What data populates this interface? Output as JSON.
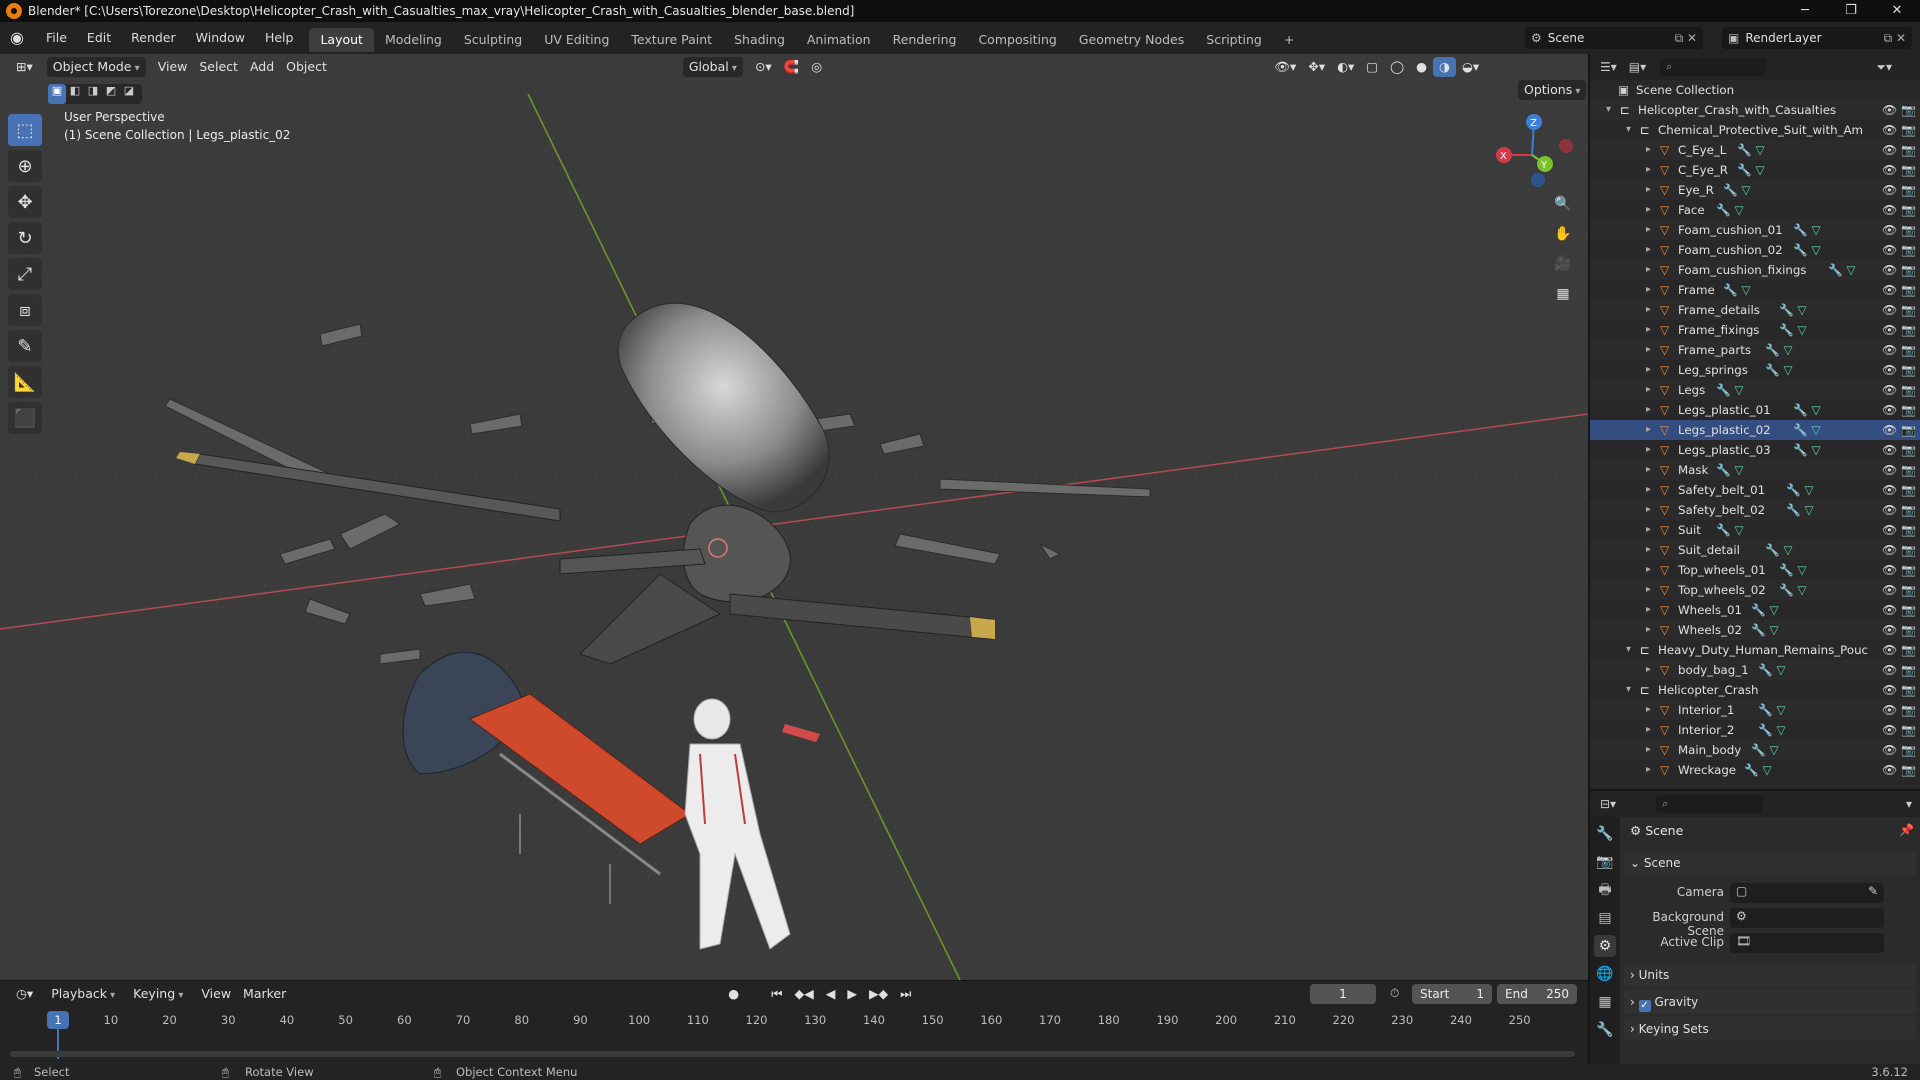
{
  "window": {
    "title": "Blender* [C:\\Users\\Torezone\\Desktop\\Helicopter_Crash_with_Casualties_max_vray\\Helicopter_Crash_with_Casualties_blender_base.blend]",
    "minimize": "─",
    "maximize": "❐",
    "close": "✕"
  },
  "menu": [
    "File",
    "Edit",
    "Render",
    "Window",
    "Help"
  ],
  "workspaces": [
    "Layout",
    "Modeling",
    "Sculpting",
    "UV Editing",
    "Texture Paint",
    "Shading",
    "Animation",
    "Rendering",
    "Compositing",
    "Geometry Nodes",
    "Scripting"
  ],
  "add_workspace": "+",
  "scene_selector": {
    "scene": "Scene",
    "view_layer": "RenderLayer"
  },
  "viewport": {
    "mode": "Object Mode",
    "menus": [
      "View",
      "Select",
      "Add",
      "Object"
    ],
    "transform_orientation": "Global",
    "options_label": "Options",
    "perspective_label": "User Perspective",
    "collection_label": "(1) Scene Collection | Legs_plastic_02",
    "gizmo_axes": {
      "x": "X",
      "y": "Y",
      "z": "Z"
    }
  },
  "tools": [
    "select-box",
    "cursor",
    "move",
    "rotate",
    "scale",
    "transform",
    "annotate",
    "measure",
    "add-cube"
  ],
  "outliner": {
    "root": "Scene Collection",
    "rows": [
      {
        "name": "Helicopter_Crash_with_Casualties",
        "level": 0,
        "type": "collection"
      },
      {
        "name": "Chemical_Protective_Suit_with_Am",
        "level": 1,
        "type": "collection"
      },
      {
        "name": "C_Eye_L",
        "level": 2,
        "type": "mesh"
      },
      {
        "name": "C_Eye_R",
        "level": 2,
        "type": "mesh"
      },
      {
        "name": "Eye_R",
        "level": 2,
        "type": "mesh"
      },
      {
        "name": "Face",
        "level": 2,
        "type": "mesh"
      },
      {
        "name": "Foam_cushion_01",
        "level": 2,
        "type": "mesh"
      },
      {
        "name": "Foam_cushion_02",
        "level": 2,
        "type": "mesh"
      },
      {
        "name": "Foam_cushion_fixings",
        "level": 2,
        "type": "mesh"
      },
      {
        "name": "Frame",
        "level": 2,
        "type": "mesh"
      },
      {
        "name": "Frame_details",
        "level": 2,
        "type": "mesh"
      },
      {
        "name": "Frame_fixings",
        "level": 2,
        "type": "mesh"
      },
      {
        "name": "Frame_parts",
        "level": 2,
        "type": "mesh"
      },
      {
        "name": "Leg_springs",
        "level": 2,
        "type": "mesh"
      },
      {
        "name": "Legs",
        "level": 2,
        "type": "mesh"
      },
      {
        "name": "Legs_plastic_01",
        "level": 2,
        "type": "mesh"
      },
      {
        "name": "Legs_plastic_02",
        "level": 2,
        "type": "mesh",
        "selected": true
      },
      {
        "name": "Legs_plastic_03",
        "level": 2,
        "type": "mesh"
      },
      {
        "name": "Mask",
        "level": 2,
        "type": "mesh"
      },
      {
        "name": "Safety_belt_01",
        "level": 2,
        "type": "mesh"
      },
      {
        "name": "Safety_belt_02",
        "level": 2,
        "type": "mesh"
      },
      {
        "name": "Suit",
        "level": 2,
        "type": "mesh"
      },
      {
        "name": "Suit_detail",
        "level": 2,
        "type": "mesh"
      },
      {
        "name": "Top_wheels_01",
        "level": 2,
        "type": "mesh"
      },
      {
        "name": "Top_wheels_02",
        "level": 2,
        "type": "mesh"
      },
      {
        "name": "Wheels_01",
        "level": 2,
        "type": "mesh"
      },
      {
        "name": "Wheels_02",
        "level": 2,
        "type": "mesh"
      },
      {
        "name": "Heavy_Duty_Human_Remains_Pouc",
        "level": 1,
        "type": "collection"
      },
      {
        "name": "body_bag_1",
        "level": 2,
        "type": "mesh"
      },
      {
        "name": "Helicopter_Crash",
        "level": 1,
        "type": "collection"
      },
      {
        "name": "Interior_1",
        "level": 2,
        "type": "mesh"
      },
      {
        "name": "Interior_2",
        "level": 2,
        "type": "mesh"
      },
      {
        "name": "Main_body",
        "level": 2,
        "type": "mesh"
      },
      {
        "name": "Wreckage",
        "level": 2,
        "type": "mesh"
      }
    ]
  },
  "properties": {
    "context_title": "Scene",
    "panel_scene": "Scene",
    "camera_label": "Camera",
    "background_scene_label": "Background Scene",
    "active_clip_label": "Active Clip",
    "panel_units": "Units",
    "panel_gravity": "Gravity",
    "gravity_checked": true,
    "panel_keying_sets": "Keying Sets"
  },
  "timeline": {
    "menus": [
      "Playback",
      "Keying",
      "View",
      "Marker"
    ],
    "current_frame": "1",
    "start_label": "Start",
    "start_value": "1",
    "end_label": "End",
    "end_value": "250",
    "ruler_current": "1",
    "ruler_ticks": [
      "10",
      "20",
      "30",
      "40",
      "50",
      "60",
      "70",
      "80",
      "90",
      "100",
      "110",
      "120",
      "130",
      "140",
      "150",
      "160",
      "170",
      "180",
      "190",
      "200",
      "210",
      "220",
      "230",
      "240",
      "250"
    ]
  },
  "statusbar": {
    "select": "Select",
    "rotate_view": "Rotate View",
    "context_menu": "Object Context Menu",
    "version": "3.6.12"
  },
  "colors": {
    "accent_blue": "#4772b3",
    "selection_row": "#334d80",
    "mesh_icon": "#e68a3a",
    "modifier_icon": "#7a9ee0",
    "data_icon": "#5fc8a8",
    "axis_x": "#d23a4a",
    "axis_y": "#7bc22e",
    "axis_z": "#3d7fd8"
  }
}
